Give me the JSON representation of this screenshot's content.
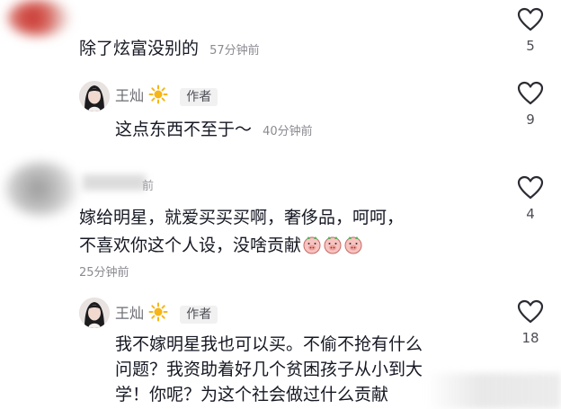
{
  "comments": [
    {
      "text": "除了炫富没别的",
      "time": "57分钟前",
      "likes": "5",
      "reply": {
        "name": "王灿",
        "badge": "作者",
        "text": "这点东西不至于～",
        "time": "40分钟前",
        "likes": "9"
      }
    },
    {
      "name_fragment": "前",
      "text_line1": "嫁给明星，就爱买买买啊，奢侈品，呵呵，",
      "text_line2": "不喜欢你这个人设，没啥贡献",
      "time": "25分钟前",
      "likes": "4",
      "reply": {
        "name": "王灿",
        "badge": "作者",
        "text_line1": "我不嫁明星我也可以买。不偷不抢有什么",
        "text_line2": "问题？我资助着好几个贫困孩子从小到大",
        "text_line3": "学！你呢？为这个社会做过什么贡献",
        "likes": "18"
      }
    }
  ],
  "icons": {
    "like": "heart-outline-icon",
    "name_badge": "sun-star-icon",
    "emoji": "pig-face-emoji"
  },
  "colors": {
    "text": "#161823",
    "muted": "#8a8b91",
    "name": "#6b6c73"
  }
}
